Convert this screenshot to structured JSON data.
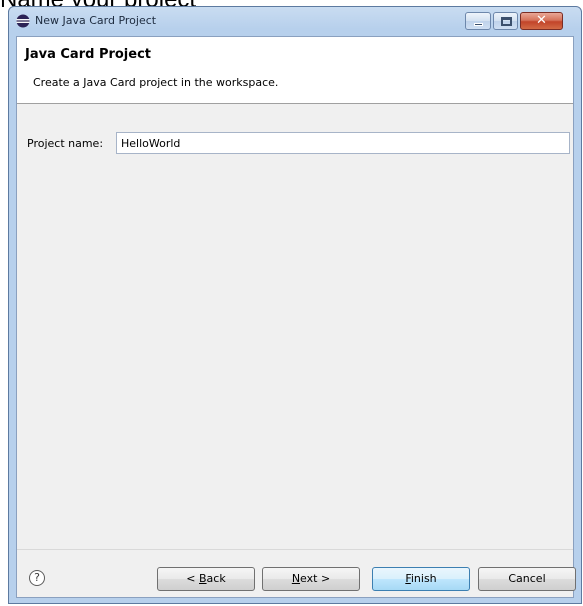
{
  "page": {
    "caption": "Name your project"
  },
  "window": {
    "title": "New Java Card Project"
  },
  "banner": {
    "title": "Java Card Project",
    "description": "Create a Java Card project in the workspace."
  },
  "form": {
    "project_name_label": "Project name:",
    "project_name_value": "HelloWorld"
  },
  "buttons": {
    "help_glyph": "?",
    "back": {
      "mnemonic": "B",
      "rest": "ack",
      "prefix": "< "
    },
    "next": {
      "mnemonic": "N",
      "rest": "ext >"
    },
    "finish": {
      "mnemonic": "F",
      "rest": "inish"
    },
    "cancel": "Cancel"
  },
  "colors": {
    "close_button": "#c2442a",
    "default_button_border": "#3c7fb1",
    "dialog_background": "#f0f0f0"
  }
}
